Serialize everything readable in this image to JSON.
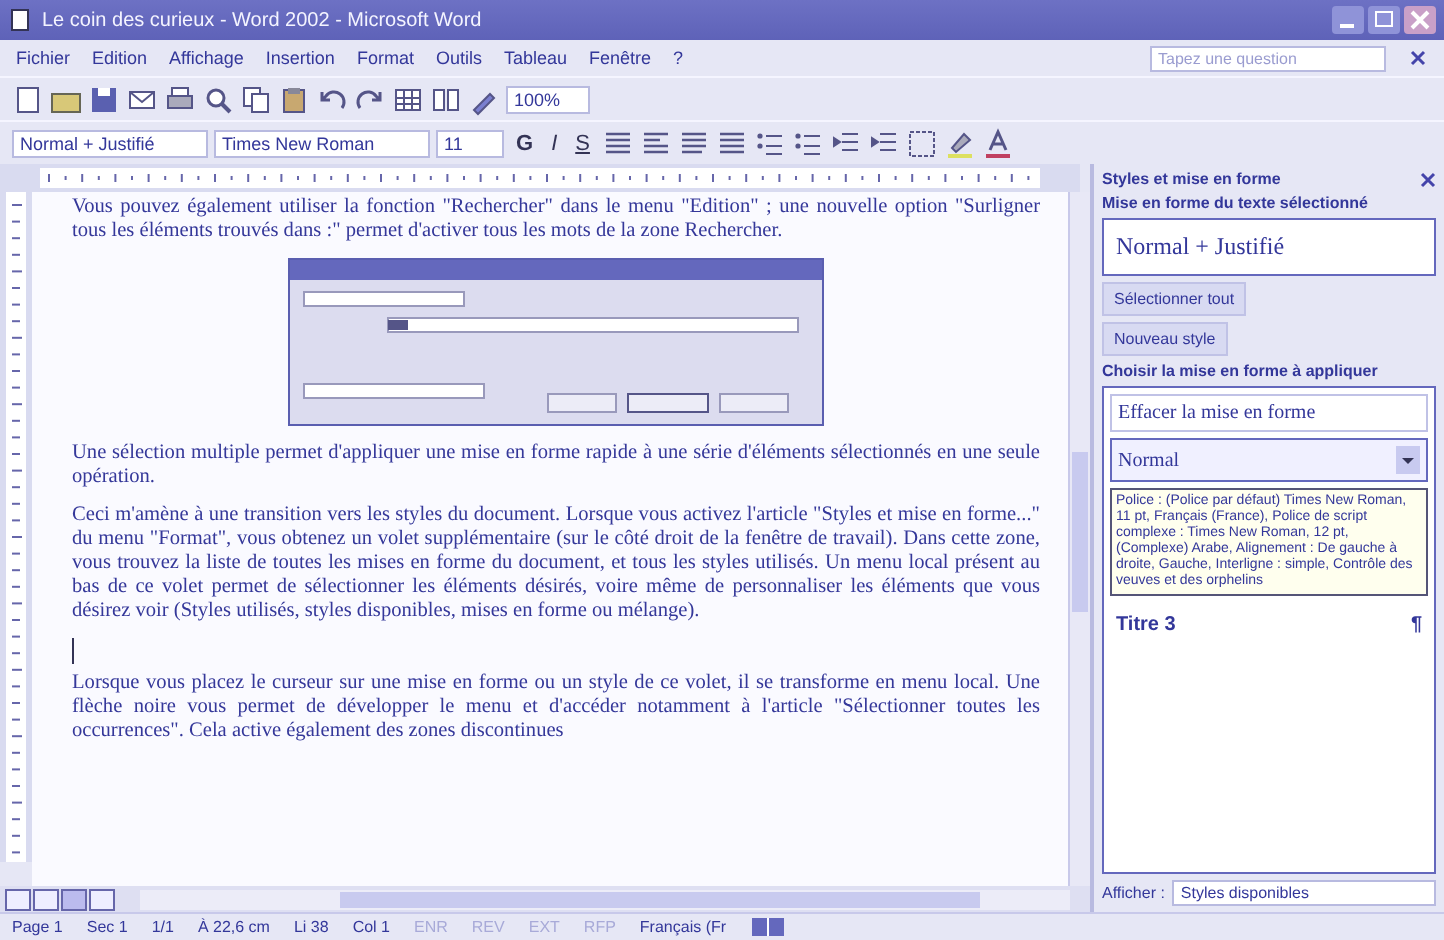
{
  "window": {
    "title": "Le coin des curieux - Word 2002 - Microsoft Word"
  },
  "menu": [
    "Fichier",
    "Edition",
    "Affichage",
    "Insertion",
    "Format",
    "Outils",
    "Tableau",
    "Fenêtre",
    "?"
  ],
  "help_box": {
    "placeholder": "Tapez une question"
  },
  "standard_toolbar": {
    "zoom": "100%"
  },
  "formatting_toolbar": {
    "style": "Normal + Justifié",
    "font": "Times New Roman",
    "size": "11",
    "text_buttons": [
      "G",
      "I",
      "S"
    ]
  },
  "document": {
    "blocks": [
      {
        "kind": "text",
        "text": "Vous pouvez également utiliser la fonction \"Rechercher\" dans le menu \"Edition\" ; une nouvelle option \"Surligner tous les éléments trouvés dans :\" permet d'activer tous les mots de la zone Rechercher."
      },
      {
        "kind": "screenshot"
      },
      {
        "kind": "text",
        "text": "Une sélection multiple permet d'appliquer une mise en forme rapide à une série d'éléments sélectionnés en une seule opération."
      },
      {
        "kind": "text",
        "text": "Ceci m'amène à une transition vers les styles du document. Lorsque vous activez l'article \"Styles et mise en forme...\" du menu \"Format\", vous obtenez un volet supplémentaire (sur le côté droit de la fenêtre de travail). Dans cette zone, vous trouvez la liste de toutes les mises en forme du document, et tous les styles utilisés. Un menu local présent au bas de ce volet permet de sélectionner les éléments désirés, voire même de personnaliser les éléments que vous désirez voir (Styles utilisés, styles disponibles, mises en forme ou mélange)."
      },
      {
        "kind": "cursor"
      },
      {
        "kind": "text",
        "text": "Lorsque vous placez le curseur sur une mise en forme ou un style de ce volet, il se transforme en menu local. Une flèche noire vous permet de développer le menu et d'accéder notamment à l'article \"Sélectionner toutes les occurrences\". Cela active également des zones discontinues"
      }
    ]
  },
  "task_pane": {
    "title": "Styles et mise en forme",
    "selected_heading": "Mise en forme du texte sélectionné",
    "current_style": "Normal + Justifié",
    "buttons": [
      "Sélectionner tout",
      "Nouveau style"
    ],
    "choose_heading": "Choisir la mise en forme à appliquer",
    "styles": [
      {
        "name": "Effacer la mise en forme",
        "selected": false
      },
      {
        "name": "Normal",
        "selected": true
      }
    ],
    "tooltip": "Police : (Police par défaut) Times New Roman, 11 pt, Français (France), Police de script complexe : Times New Roman, 12 pt, (Complexe) Arabe, Alignement : De gauche à droite, Gauche, Interligne : simple, Contrôle des veuves et des orphelins",
    "heading_style": {
      "name": "Titre 3",
      "mark": "¶"
    },
    "show_label": "Afficher :",
    "show_value": "Styles disponibles"
  },
  "status_bar": {
    "items": [
      "Page 1",
      "Sec 1",
      "1/1",
      "À 22,6 cm",
      "Li 38",
      "Col 1"
    ],
    "modes": [
      {
        "label": "ENR",
        "disabled": true
      },
      {
        "label": "REV",
        "disabled": true
      },
      {
        "label": "EXT",
        "disabled": true
      },
      {
        "label": "RFP",
        "disabled": true
      }
    ],
    "language": "Français (Fr"
  }
}
